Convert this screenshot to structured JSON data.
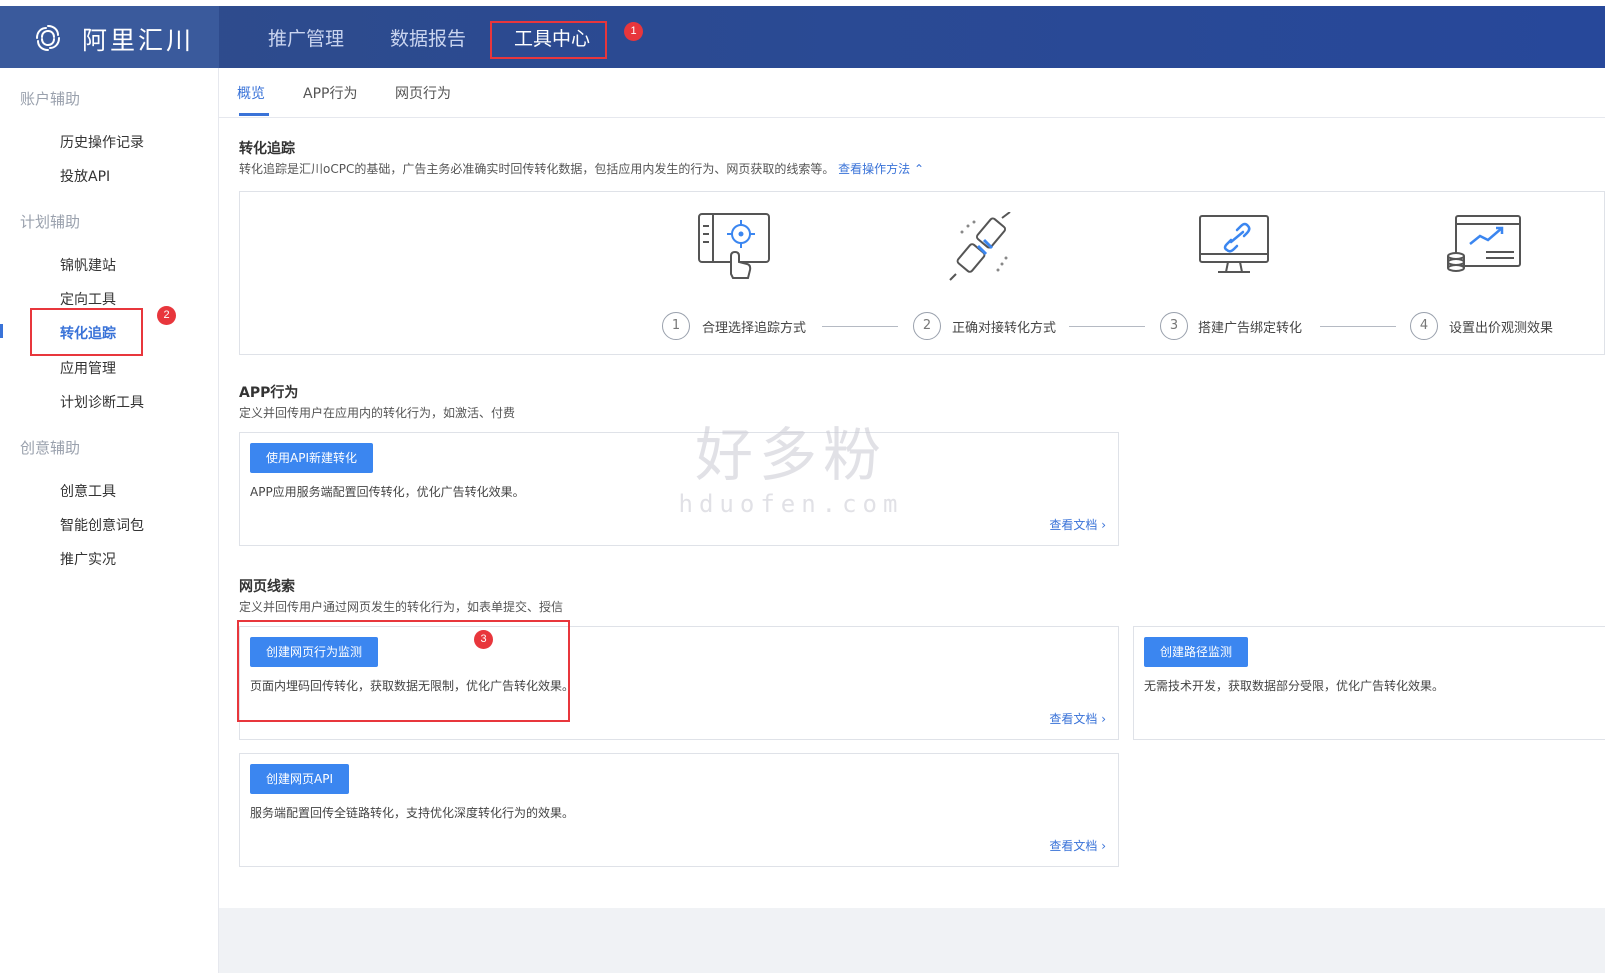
{
  "brand": {
    "name": "阿里汇川"
  },
  "topnav": {
    "items": [
      "推广管理",
      "数据报告",
      "工具中心"
    ],
    "active_index": 2
  },
  "sidebar": {
    "groups": [
      {
        "label": "账户辅助",
        "items": [
          "历史操作记录",
          "投放API"
        ]
      },
      {
        "label": "计划辅助",
        "items": [
          "锦帆建站",
          "定向工具",
          "转化追踪",
          "应用管理",
          "计划诊断工具"
        ]
      },
      {
        "label": "创意辅助",
        "items": [
          "创意工具",
          "智能创意词包",
          "推广实况"
        ]
      }
    ],
    "active_item": "转化追踪"
  },
  "tabs": {
    "items": [
      "概览",
      "APP行为",
      "网页行为"
    ],
    "active_index": 0
  },
  "tracking": {
    "title": "转化追踪",
    "desc": "转化追踪是汇川oCPC的基础，广告主务必准确实时回传转化数据，包括应用内发生的行为、网页获取的线索等。",
    "link": "查看操作方法",
    "steps": [
      {
        "num": "1",
        "label": "合理选择追踪方式",
        "icon": "tracking-tablet-icon"
      },
      {
        "num": "2",
        "label": "正确对接转化方式",
        "icon": "plug-connect-icon"
      },
      {
        "num": "3",
        "label": "搭建广告绑定转化",
        "icon": "monitor-link-icon"
      },
      {
        "num": "4",
        "label": "设置出价观测效果",
        "icon": "chart-data-icon"
      }
    ]
  },
  "app_section": {
    "title": "APP行为",
    "desc": "定义并回传用户在应用内的转化行为，如激活、付费",
    "card": {
      "button": "使用API新建转化",
      "desc": "APP应用服务端配置回传转化，优化广告转化效果。",
      "doc_link": "查看文档"
    }
  },
  "web_section": {
    "title": "网页线索",
    "desc": "定义并回传用户通过网页发生的转化行为，如表单提交、授信",
    "cards": [
      {
        "button": "创建网页行为监测",
        "desc": "页面内埋码回传转化，获取数据无限制，优化广告转化效果。",
        "doc_link": "查看文档"
      },
      {
        "button": "创建路径监测",
        "desc": "无需技术开发，获取数据部分受限，优化广告转化效果。"
      },
      {
        "button": "创建网页API",
        "desc": "服务端配置回传全链路转化，支持优化深度转化行为的效果。",
        "doc_link": "查看文档"
      }
    ]
  },
  "annotations": {
    "badges": [
      "1",
      "2",
      "3"
    ],
    "color": "#e8363c"
  },
  "watermark": {
    "cn": "好多粉",
    "en": "hduofen.com"
  },
  "colors": {
    "accent": "#3a73d8",
    "button": "#3b86f0",
    "topbar": "#2b4a92"
  }
}
